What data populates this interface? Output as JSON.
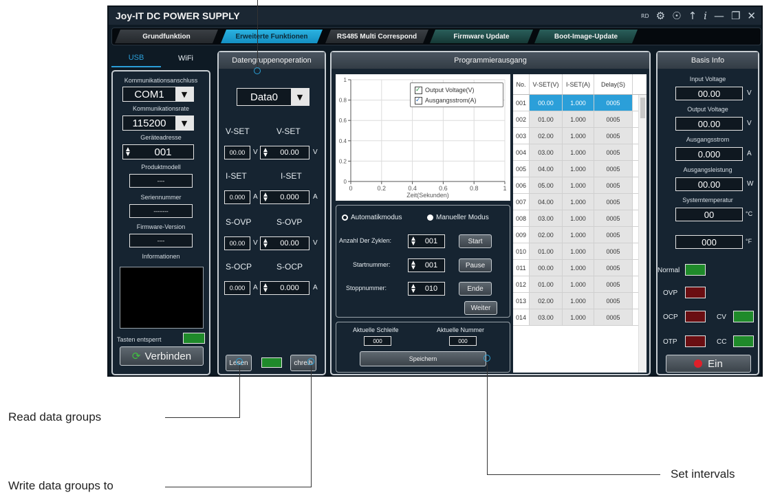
{
  "window": {
    "title": "Joy-IT DC POWER SUPPLY",
    "rd_label": "RD"
  },
  "tabs": [
    {
      "label": "Grundfunktion"
    },
    {
      "label": "Erweiterte Funktionen"
    },
    {
      "label": "RS485 Multi Correspond"
    },
    {
      "label": "Firmware Update"
    },
    {
      "label": "Boot-Image-Update"
    }
  ],
  "left": {
    "tab_usb": "USB",
    "tab_wifi": "WiFi",
    "port_label": "Kommunikationsanschluss",
    "port_value": "COM1",
    "rate_label": "Kommunikationsrate",
    "rate_value": "115200",
    "addr_label": "Geräteadresse",
    "addr_value": "001",
    "model_label": "Produktmodell",
    "model_value": "----",
    "serial_label": "Seriennummer",
    "serial_value": "--------",
    "fw_label": "Firmware-Version",
    "fw_value": "----",
    "info_label": "Informationen",
    "keys_label": "Tasten entsperrt",
    "connect_label": "Verbinden"
  },
  "datagroup": {
    "header": "Datengruppenoperation",
    "select_value": "Data0",
    "vset_l": "V-SET",
    "vset_r": "V-SET",
    "vset_left": "00.00",
    "vset_right": "00.00",
    "iset_l": "I-SET",
    "iset_r": "I-SET",
    "iset_left": "0.000",
    "iset_right": "0.000",
    "ovp_l": "S-OVP",
    "ovp_r": "S-OVP",
    "ovp_left": "00.00",
    "ovp_right": "00.00",
    "ocp_l": "S-OCP",
    "ocp_r": "S-OCP",
    "ocp_left": "0.000",
    "ocp_right": "0.000",
    "unit_v": "V",
    "unit_a": "A",
    "read_label": "Lesen",
    "write_label": "chreib"
  },
  "program": {
    "header": "Programmierausgang",
    "legend_voltage": "Output Voltage(V)",
    "legend_current": "Ausgangsstrom(A)",
    "xlabel": "Zeit(Sekunden)",
    "mode_auto": "Automatikmodus",
    "mode_manual": "Manueller Modus",
    "cycles_label": "Anzahl Der Zyklen:",
    "cycles_value": "001",
    "start_label": "Startnummer:",
    "start_value": "001",
    "stop_label": "Stoppnummer:",
    "stop_value": "010",
    "btn_start": "Start",
    "btn_pause": "Pause",
    "btn_end": "Ende",
    "btn_next": "Weiter",
    "loop_label": "Aktuelle Schleife",
    "loop_value": "000",
    "num_label": "Aktuelle Nummer",
    "num_value": "000",
    "save_label": "Speichern"
  },
  "table": {
    "headers": [
      "No.",
      "V-SET(V)",
      "I-SET(A)",
      "Delay(S)"
    ],
    "rows": [
      [
        "001",
        "00.00",
        "1.000",
        "0005"
      ],
      [
        "002",
        "01.00",
        "1.000",
        "0005"
      ],
      [
        "003",
        "02.00",
        "1.000",
        "0005"
      ],
      [
        "004",
        "03.00",
        "1.000",
        "0005"
      ],
      [
        "005",
        "04.00",
        "1.000",
        "0005"
      ],
      [
        "006",
        "05.00",
        "1.000",
        "0005"
      ],
      [
        "007",
        "04.00",
        "1.000",
        "0005"
      ],
      [
        "008",
        "03.00",
        "1.000",
        "0005"
      ],
      [
        "009",
        "02.00",
        "1.000",
        "0005"
      ],
      [
        "010",
        "01.00",
        "1.000",
        "0005"
      ],
      [
        "011",
        "00.00",
        "1.000",
        "0005"
      ],
      [
        "012",
        "01.00",
        "1.000",
        "0005"
      ],
      [
        "013",
        "02.00",
        "1.000",
        "0005"
      ],
      [
        "014",
        "03.00",
        "1.000",
        "0005"
      ]
    ]
  },
  "basis": {
    "header": "Basis Info",
    "in_v_label": "Input Voltage",
    "in_v_value": "00.00",
    "out_v_label": "Output Voltage",
    "out_v_value": "00.00",
    "out_i_label": "Ausgangsstrom",
    "out_i_value": "0.000",
    "out_p_label": "Ausgangsleistung",
    "out_p_value": "00.00",
    "temp_label": "Systemtemperatur",
    "temp_c_value": "00",
    "temp_f_value": "000",
    "unit_v": "V",
    "unit_a": "A",
    "unit_w": "W",
    "unit_c": "°C",
    "unit_f": "°F",
    "normal": "Normal",
    "ovp": "OVP",
    "ocp": "OCP",
    "otp": "OTP",
    "cv": "CV",
    "cc": "CC",
    "power_label": "Ein"
  },
  "annotations": {
    "read": "Read data groups",
    "write": "Write data groups to",
    "intervals": "Set intervals"
  },
  "chart_data": {
    "type": "line",
    "x": [],
    "series": [
      {
        "name": "Output Voltage(V)",
        "values": []
      },
      {
        "name": "Ausgangsstrom(A)",
        "values": []
      }
    ],
    "xlim": [
      0,
      1
    ],
    "ylim": [
      0,
      1
    ],
    "xticks": [
      "0",
      "0.2",
      "0.4",
      "0.6",
      "0.8",
      "1"
    ],
    "yticks": [
      "0",
      "0.2",
      "0.4",
      "0.6",
      "0.8",
      "1"
    ],
    "xlabel": "Zeit(Sekunden)",
    "grid": true,
    "legend": "top-right"
  },
  "colors": {
    "accent": "#2b9fd9",
    "led_green": "#1f8a2a",
    "led_red": "#6a0e12",
    "bg": "#0e1a24"
  }
}
